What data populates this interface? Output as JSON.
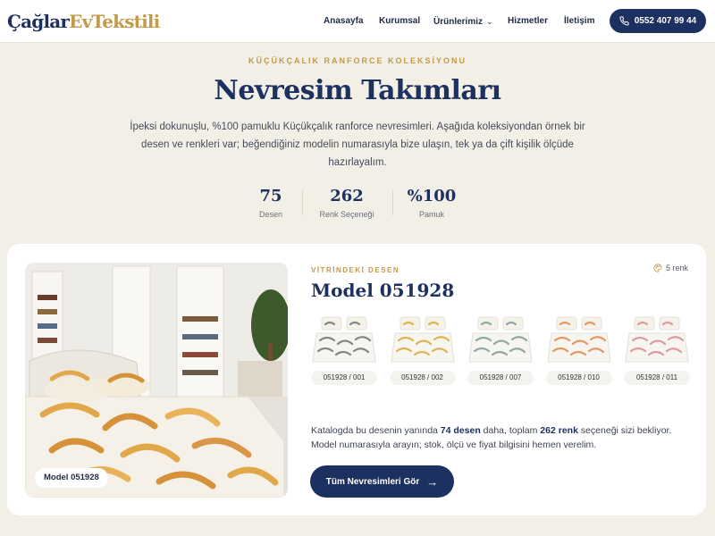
{
  "nav": {
    "logo_part1": "Çağlar",
    "logo_part2": "EvTekstili",
    "links": [
      "Anasayfa",
      "Kurumsal",
      "Ürünlerimiz",
      "Hizmetler",
      "İletişim"
    ],
    "dropdown_icon": "chevron-down-icon",
    "phone": "0552 407 99 44",
    "phone_icon": "phone-icon"
  },
  "hero": {
    "eyebrow": "KÜÇÜKÇALIK RANFORCE KOLEKSİYONU",
    "title": "Nevresim Takımları",
    "description": "İpeksi dokunuşlu, %100 pamuklu Küçükçalık ranforce nevresimleri. Aşağıda koleksiyondan örnek bir desen ve renkleri var; beğendiğiniz modelin numarasıyla bize ulaşın, tek ya da çift kişilik ölçüde hazırlayalım.",
    "stats": [
      {
        "value": "75",
        "label": "Desen"
      },
      {
        "value": "262",
        "label": "Renk Seçeneği"
      },
      {
        "value": "%100",
        "label": "Pamuk"
      }
    ]
  },
  "featured": {
    "photo_badge": "Model 051928",
    "label": "VİTRİNDEKİ DESEN",
    "title": "Model 051928",
    "color_count": "5 renk",
    "color_count_icon": "palette-icon",
    "variants": [
      {
        "code": "051928 / 001",
        "color": "#6f7378"
      },
      {
        "code": "051928 / 002",
        "color": "#d8a836"
      },
      {
        "code": "051928 / 007",
        "color": "#7e9a96"
      },
      {
        "code": "051928 / 010",
        "color": "#e0884a"
      },
      {
        "code": "051928 / 011",
        "color": "#d98b8f"
      }
    ],
    "desc_part1": "Katalogda bu desenin yanında ",
    "desc_bold1": "74 desen",
    "desc_part2": " daha, toplam ",
    "desc_bold2": "262 renk",
    "desc_part3": " seçeneği sizi bekliyor. Model numarasıyla arayın; stok, ölçü ve fiyat bilgisini hemen verelim.",
    "cta": "Tüm Nevresimleri Gör",
    "cta_icon": "arrow-right-icon"
  },
  "colors": {
    "navy": "#1d3161",
    "gold": "#c29a4a",
    "background": "#f2efe7"
  }
}
